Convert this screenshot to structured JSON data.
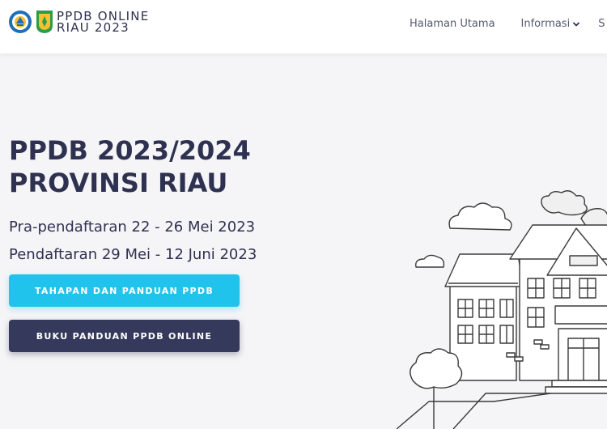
{
  "brand": {
    "line1": "PPDB ONLINE",
    "line2": "RIAU 2023"
  },
  "nav": {
    "home": "Halaman Utama",
    "info": "Informasi",
    "next": "S"
  },
  "hero": {
    "title_line1": "PPDB 2023/2024",
    "title_line2": "PROVINSI RIAU",
    "pre_registration": "Pra-pendaftaran 22 - 26 Mei 2023",
    "registration": "Pendaftaran 29 Mei - 12 Juni 2023"
  },
  "buttons": {
    "stages": "TAHAPAN DAN PANDUAN PPDB",
    "guide": "BUKU PANDUAN PPDB ONLINE"
  },
  "icons": {
    "logo1": "tut-wuri-handayani-logo",
    "logo2": "riau-province-emblem",
    "dropdown": "chevron-down-icon"
  },
  "colors": {
    "primary": "#20c3ec",
    "dark": "#353a5c",
    "text": "#2e3150"
  }
}
